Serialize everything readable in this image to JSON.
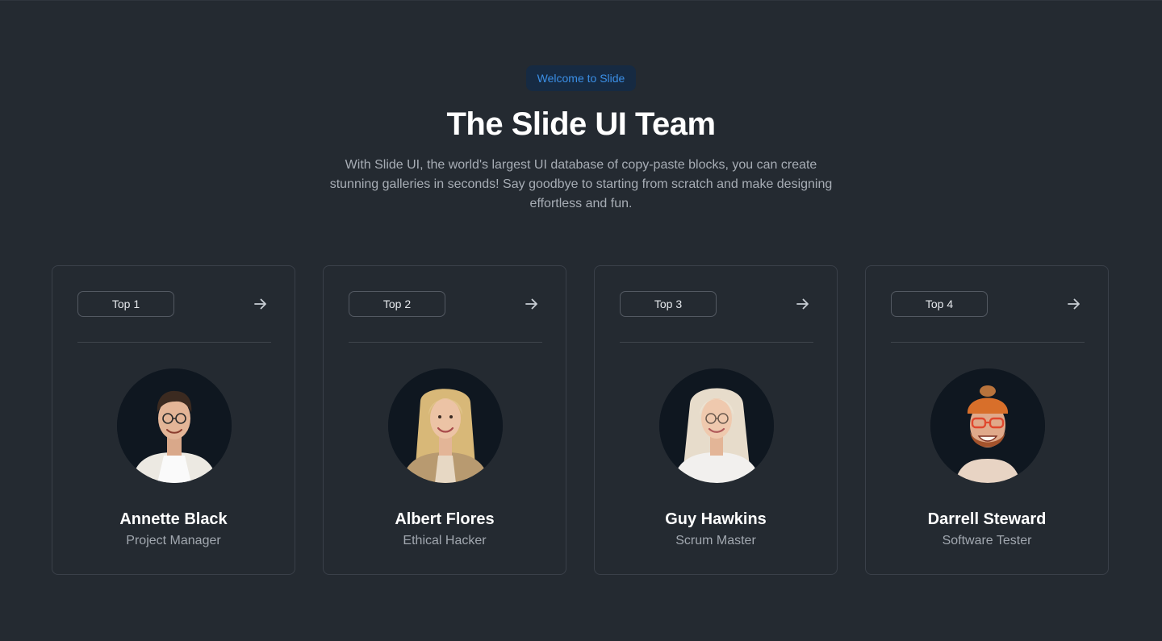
{
  "header": {
    "badge": "Welcome to Slide",
    "title": "The Slide UI Team",
    "subtitle": "With Slide UI, the world's largest UI database of copy-paste blocks, you can create stunning galleries in seconds! Say goodbye to starting from scratch and make designing effortless and fun."
  },
  "colors": {
    "background": "#242a31",
    "badge_bg": "#162a42",
    "badge_text": "#3b8fe6",
    "card_border": "#3a4049"
  },
  "team": [
    {
      "rank": "Top 1",
      "name": "Annette Black",
      "role": "Project Manager",
      "arrow_icon": "arrow-right-icon",
      "avatar": "man-with-glasses-photo"
    },
    {
      "rank": "Top 2",
      "name": "Albert Flores",
      "role": "Ethical Hacker",
      "arrow_icon": "arrow-right-icon",
      "avatar": "blonde-woman-photo"
    },
    {
      "rank": "Top 3",
      "name": "Guy Hawkins",
      "role": "Scrum Master",
      "arrow_icon": "arrow-right-icon",
      "avatar": "woman-with-glasses-photo"
    },
    {
      "rank": "Top 4",
      "name": "Darrell Steward",
      "role": "Software Tester",
      "arrow_icon": "arrow-right-icon",
      "avatar": "bearded-man-orange-beanie-photo"
    }
  ]
}
